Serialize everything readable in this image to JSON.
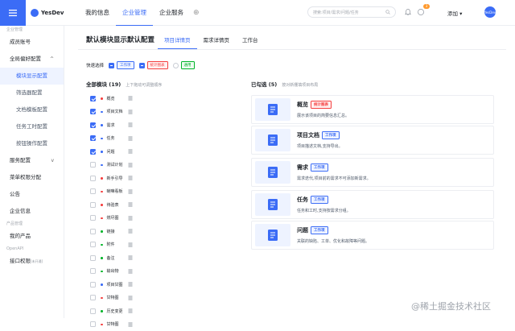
{
  "app": {
    "name": "YesDev"
  },
  "nav": {
    "items": [
      {
        "label": "我的信息",
        "active": false
      },
      {
        "label": "企业管理",
        "active": true
      },
      {
        "label": "企业服务",
        "active": false
      }
    ],
    "add_icon": "plus-icon"
  },
  "search": {
    "placeholder": "搜索:项目/需求/问题/任务"
  },
  "header": {
    "notification_badge": "3",
    "add_label": "添加 ▾",
    "avatar_text": "YesDev"
  },
  "sidebar": {
    "group1": "企业管理",
    "items": [
      {
        "label": "成员账号"
      },
      {
        "label": "全局偏好配置",
        "chevron": "^"
      },
      {
        "label": "模块显示配置",
        "sub": true,
        "active": true
      },
      {
        "label": "筛选器配置",
        "sub": true
      },
      {
        "label": "文档模板配置",
        "sub": true
      },
      {
        "label": "任务工时配置",
        "sub": true
      },
      {
        "label": "按钮操作配置",
        "sub": true
      },
      {
        "label": "服务配置",
        "chevron": "v"
      },
      {
        "label": "菜单权限分配"
      },
      {
        "label": "公告"
      },
      {
        "label": "企业信息"
      }
    ],
    "group2": "产品管理",
    "items2": [
      {
        "label": "我的产品"
      }
    ],
    "group3": "OpenAPI",
    "items3": [
      {
        "label": "接口权限",
        "badge": "[未开通]"
      }
    ]
  },
  "page": {
    "title": "默认模块显示默认配置",
    "tabs": [
      {
        "label": "项目详情页",
        "active": true
      },
      {
        "label": "需求详情页",
        "active": false
      },
      {
        "label": "工作台",
        "active": false
      }
    ]
  },
  "quick_select": {
    "label": "快速选择",
    "options": [
      {
        "label": "工作项",
        "color": "blue",
        "state": "partial"
      },
      {
        "label": "统计图表",
        "color": "red",
        "state": "partial"
      },
      {
        "label": "通用",
        "color": "green",
        "state": "off"
      }
    ]
  },
  "all_modules": {
    "title": "全部模块 (19)",
    "hint": "上下拖动可调整顺序",
    "items": [
      {
        "name": "概览",
        "checked": true,
        "dot": "#f53f3f"
      },
      {
        "name": "项目文档",
        "checked": true,
        "dot": "#3b6cf6"
      },
      {
        "name": "需求",
        "checked": true,
        "dot": "#3b6cf6"
      },
      {
        "name": "任务",
        "checked": true,
        "dot": "#3b6cf6"
      },
      {
        "name": "问题",
        "checked": true,
        "dot": "#3b6cf6"
      },
      {
        "name": "测试计划",
        "checked": false,
        "dot": "#3b6cf6"
      },
      {
        "name": "新手引导",
        "checked": false,
        "dot": "#f53f3f"
      },
      {
        "name": "喇嘛看板",
        "checked": false,
        "dot": "#f53f3f"
      },
      {
        "name": "待验表",
        "checked": false,
        "dot": "#f53f3f"
      },
      {
        "name": "燃尽图",
        "checked": false,
        "dot": "#f53f3f"
      },
      {
        "name": "链接",
        "checked": false,
        "dot": "#00b42a"
      },
      {
        "name": "附件",
        "checked": false,
        "dot": "#00b42a"
      },
      {
        "name": "备注",
        "checked": false,
        "dot": "#00b42a"
      },
      {
        "name": "输出物",
        "checked": false,
        "dot": "#00b42a"
      },
      {
        "name": "项目甘图",
        "checked": false,
        "dot": "#3b6cf6"
      },
      {
        "name": "甘特图",
        "checked": false,
        "dot": "#f53f3f"
      },
      {
        "name": "历史变更",
        "checked": false,
        "dot": "#00b42a"
      },
      {
        "name": "甘特图",
        "checked": false,
        "dot": "#f53f3f"
      }
    ]
  },
  "selected": {
    "title": "已勾选 (5)",
    "hint": "按对新栅填项目布局",
    "cards": [
      {
        "title": "概览",
        "tag": "统计图表",
        "tag_color": "red",
        "desc": "展示该项目的简要信息汇总。",
        "icon": "doc-list-icon"
      },
      {
        "title": "项目文档",
        "tag": "工作项",
        "tag_color": "blue",
        "desc": "项目描述文档,支持导出。",
        "icon": "doc-icon"
      },
      {
        "title": "需求",
        "tag": "工作项",
        "tag_color": "blue",
        "desc": "需求迭代,项目前的需求不可添加新需求。",
        "icon": "requirement-icon"
      },
      {
        "title": "任务",
        "tag": "工作项",
        "tag_color": "blue",
        "desc": "任务和工时,支持按需求分组。",
        "icon": "task-icon"
      },
      {
        "title": "问题",
        "tag": "工作项",
        "tag_color": "blue",
        "desc": "关联的缺陷、工单、优化和故障等问题。",
        "icon": "issue-icon"
      }
    ]
  },
  "watermark": "@稀土掘金技术社区"
}
